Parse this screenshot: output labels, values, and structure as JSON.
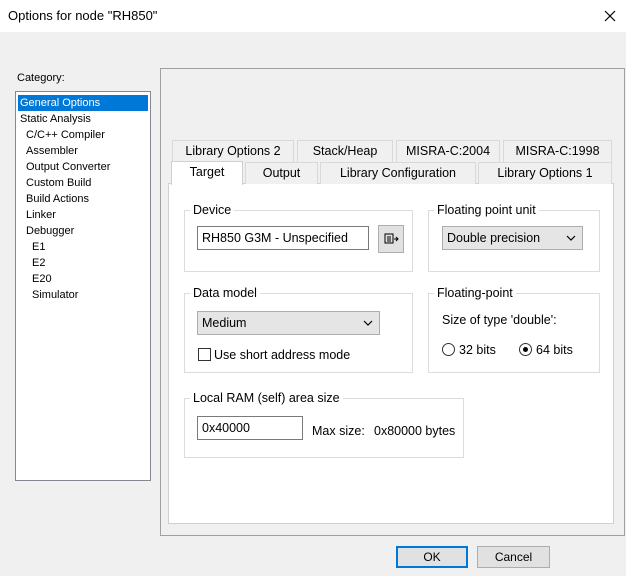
{
  "window": {
    "title": "Options for node \"RH850\""
  },
  "category": {
    "label": "Category:",
    "items": [
      {
        "label": "General Options",
        "selected": true
      },
      {
        "label": "Static Analysis"
      },
      {
        "label": "C/C++ Compiler"
      },
      {
        "label": "Assembler"
      },
      {
        "label": "Output Converter"
      },
      {
        "label": "Custom Build"
      },
      {
        "label": "Build Actions"
      },
      {
        "label": "Linker"
      },
      {
        "label": "Debugger"
      },
      {
        "label": "E1"
      },
      {
        "label": "E2"
      },
      {
        "label": "E20"
      },
      {
        "label": "Simulator"
      }
    ]
  },
  "tabs": {
    "back_row": [
      "Library Options 2",
      "Stack/Heap",
      "MISRA-C:2004",
      "MISRA-C:1998"
    ],
    "front_row": [
      "Target",
      "Output",
      "Library Configuration",
      "Library Options 1"
    ],
    "active": "Target"
  },
  "device": {
    "title": "Device",
    "value": "RH850 G3M - Unspecified"
  },
  "fpu": {
    "title": "Floating point unit",
    "value": "Double precision"
  },
  "data_model": {
    "title": "Data model",
    "value": "Medium",
    "short_address_label": "Use short address mode",
    "short_address_checked": false
  },
  "floating_point": {
    "title": "Floating-point",
    "size_label": "Size of type 'double':",
    "opt32": "32 bits",
    "opt64": "64 bits",
    "selected": "64 bits"
  },
  "local_ram": {
    "title": "Local RAM (self) area size",
    "value": "0x40000",
    "max_label": "Max size:",
    "max_value": "0x80000 bytes"
  },
  "buttons": {
    "ok": "OK",
    "cancel": "Cancel"
  },
  "colors": {
    "selection": "#0078d7",
    "window_bg": "#f0f0f0"
  }
}
